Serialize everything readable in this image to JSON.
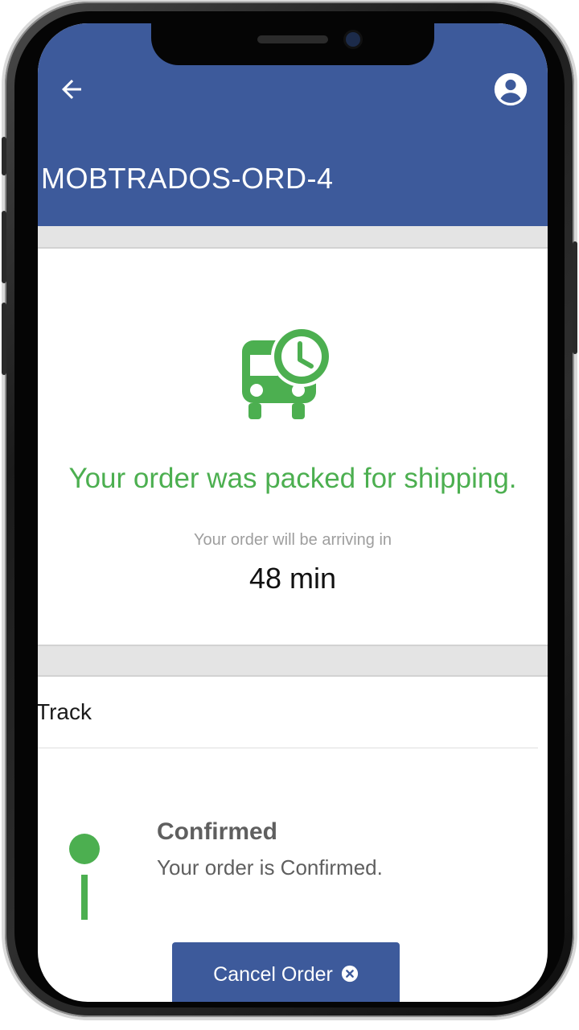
{
  "header": {
    "order_id": "MOBTRADOS-ORD-4",
    "back_icon": "arrow-left-icon",
    "profile_icon": "account-circle-icon",
    "background_color": "#3d5a9b"
  },
  "status": {
    "icon": "truck-clock-icon",
    "message": "Your order was packed for shipping.",
    "arrival_label": "Your order will be arriving in",
    "arrival_value": "48 min",
    "accent_color": "#4caf50"
  },
  "track": {
    "title": "Track",
    "steps": [
      {
        "title": "Confirmed",
        "description": "Your order is Confirmed."
      }
    ]
  },
  "actions": {
    "cancel_label": "Cancel Order",
    "cancel_icon": "close-circle-icon"
  }
}
